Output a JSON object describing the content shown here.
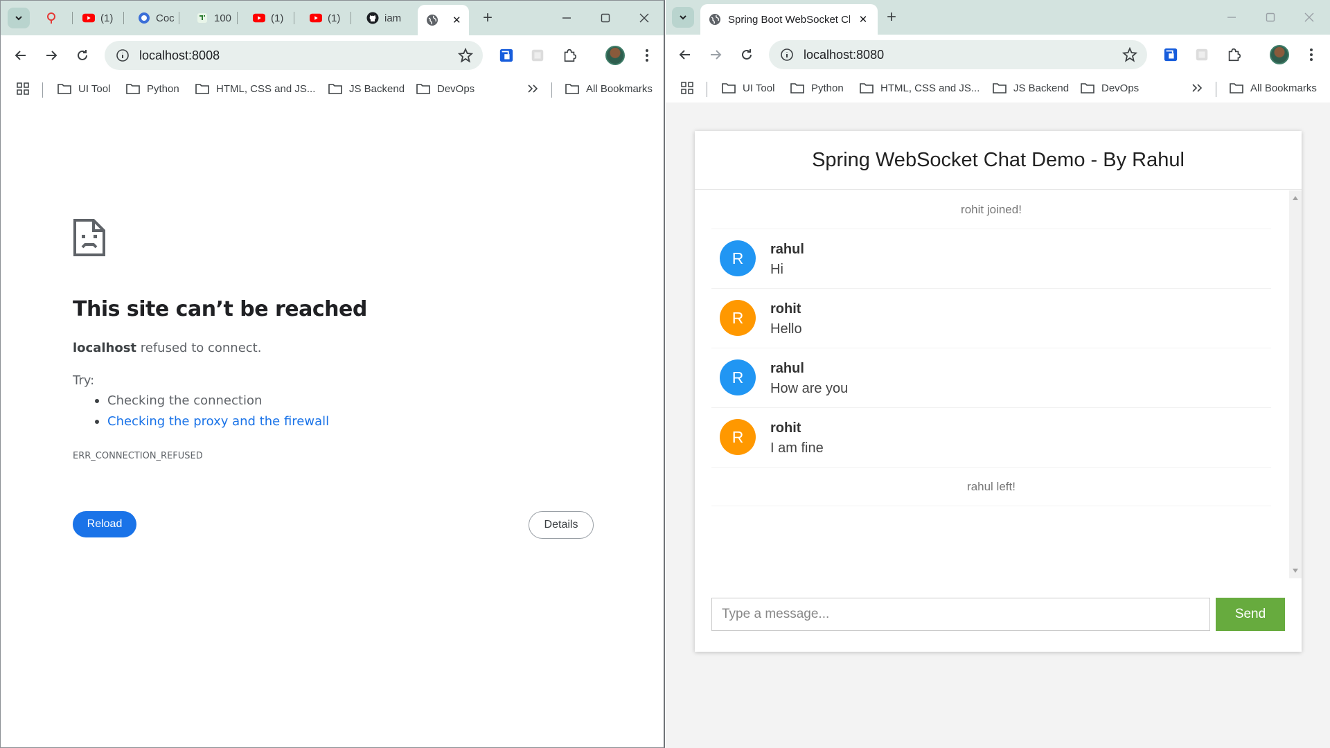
{
  "left_window": {
    "tabs": [
      {
        "icon": "pin-icon",
        "label": ""
      },
      {
        "icon": "youtube-icon",
        "label": "(1)"
      },
      {
        "icon": "coc-icon",
        "label": "Coc"
      },
      {
        "icon": "app-icon",
        "label": "100"
      },
      {
        "icon": "youtube-icon",
        "label": "(1)"
      },
      {
        "icon": "youtube-icon",
        "label": "(1)"
      },
      {
        "icon": "github-icon",
        "label": "iam"
      }
    ],
    "active_tab": {
      "icon": "globe-icon",
      "title": ""
    },
    "address": "localhost:8008",
    "bookmarks": [
      "UI Tool",
      "Python",
      "HTML, CSS and JS...",
      "JS Backend",
      "DevOps"
    ],
    "all_bookmarks": "All Bookmarks",
    "error": {
      "title": "This site can’t be reached",
      "host": "localhost",
      "message": "refused to connect.",
      "try_label": "Try:",
      "suggestions": [
        "Checking the connection",
        "Checking the proxy and the firewall"
      ],
      "code": "ERR_CONNECTION_REFUSED",
      "reload_label": "Reload",
      "details_label": "Details"
    }
  },
  "right_window": {
    "active_tab": {
      "icon": "globe-icon",
      "title": "Spring Boot WebSocket Chat Ap"
    },
    "address": "localhost:8080",
    "bookmarks": [
      "UI Tool",
      "Python",
      "HTML, CSS and JS...",
      "JS Backend",
      "DevOps"
    ],
    "all_bookmarks": "All Bookmarks",
    "chat": {
      "title": "Spring WebSocket Chat Demo - By Rahul",
      "events": [
        "rohit joined!",
        "rahul left!"
      ],
      "messages": [
        {
          "sender": "rahul",
          "text": "Hi",
          "initial": "R",
          "color": "#2196f3"
        },
        {
          "sender": "rohit",
          "text": "Hello",
          "initial": "R",
          "color": "#ff9800"
        },
        {
          "sender": "rahul",
          "text": "How are you",
          "initial": "R",
          "color": "#2196f3"
        },
        {
          "sender": "rohit",
          "text": "I am fine",
          "initial": "R",
          "color": "#ff9800"
        }
      ],
      "input_placeholder": "Type a message...",
      "send_label": "Send"
    }
  },
  "colors": {
    "tabstrip": "#d3e3df",
    "link_blue": "#1a73e8",
    "send_green": "#67ab3e",
    "avatar_blue": "#2196f3",
    "avatar_orange": "#ff9800"
  }
}
